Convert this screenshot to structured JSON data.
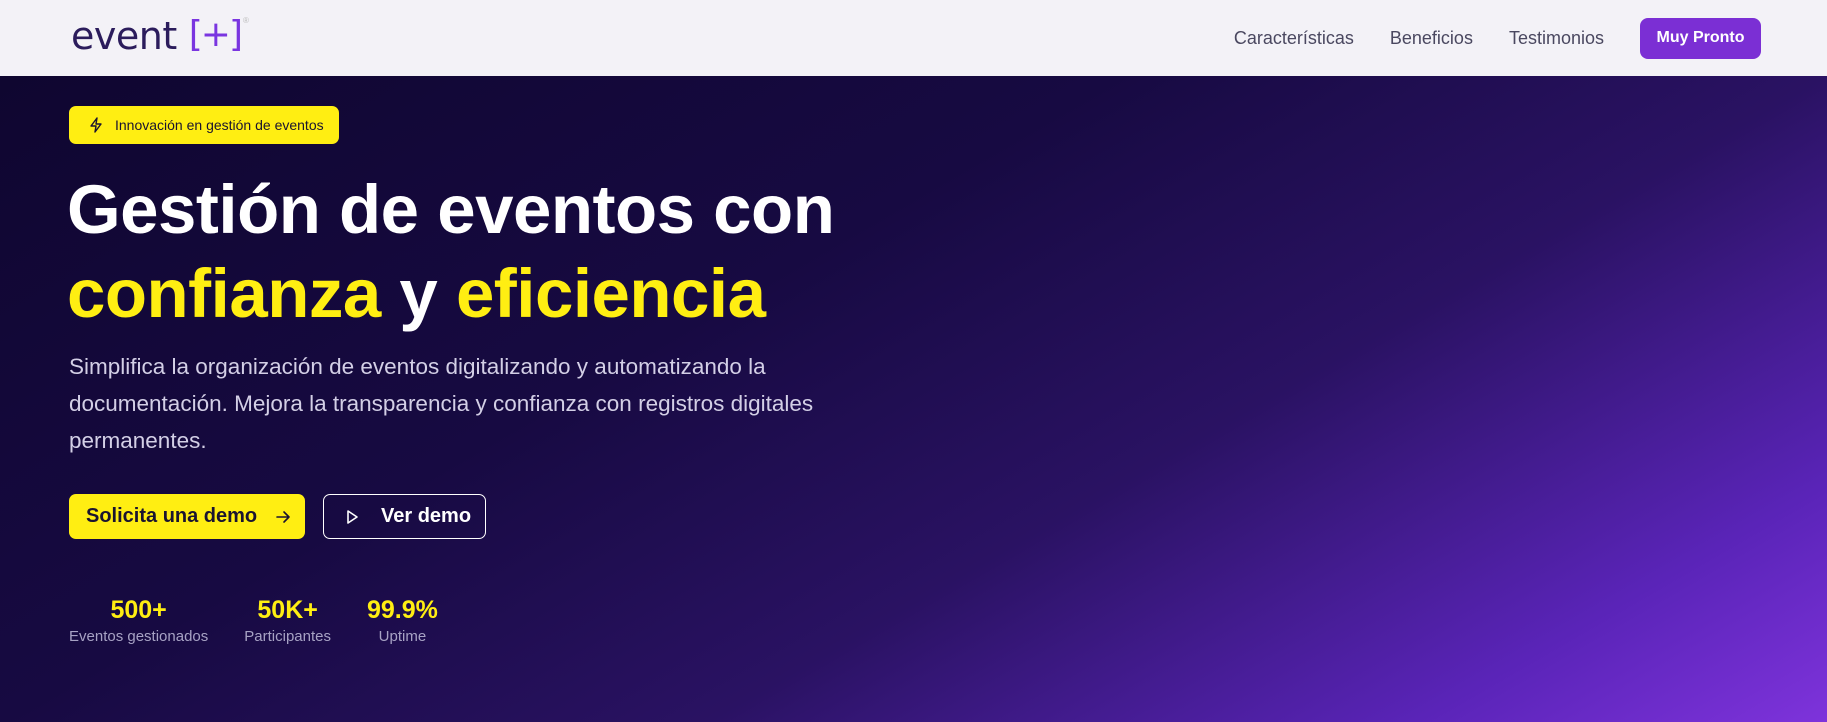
{
  "header": {
    "logo": {
      "word": "event",
      "bracket": "[+]",
      "reg": "®"
    },
    "nav": [
      {
        "label": "Características"
      },
      {
        "label": "Beneficios"
      },
      {
        "label": "Testimonios"
      }
    ],
    "cta_label": "Muy Pronto"
  },
  "hero": {
    "badge": {
      "icon": "lightning-icon",
      "text": "Innovación en gestión de eventos"
    },
    "title": {
      "line1": "Gestión de eventos con",
      "highlight1": "confianza",
      "connector": " y ",
      "highlight2": "eficiencia"
    },
    "description": "Simplifica la organización de eventos digitalizando y automatizando la documentación. Mejora la transparencia y confianza con registros digitales permanentes.",
    "primary_button": {
      "label": "Solicita una demo",
      "icon": "arrow-right-icon"
    },
    "secondary_button": {
      "label": "Ver demo",
      "icon": "play-icon"
    },
    "stats": [
      {
        "value": "500+",
        "label": "Eventos gestionados"
      },
      {
        "value": "50K+",
        "label": "Participantes"
      },
      {
        "value": "99.9%",
        "label": "Uptime"
      }
    ]
  },
  "colors": {
    "accent_yellow": "#ffee12",
    "brand_purple": "#7b2fd4",
    "hero_dark": "#0f0630",
    "header_bg": "#f3f2f7"
  }
}
